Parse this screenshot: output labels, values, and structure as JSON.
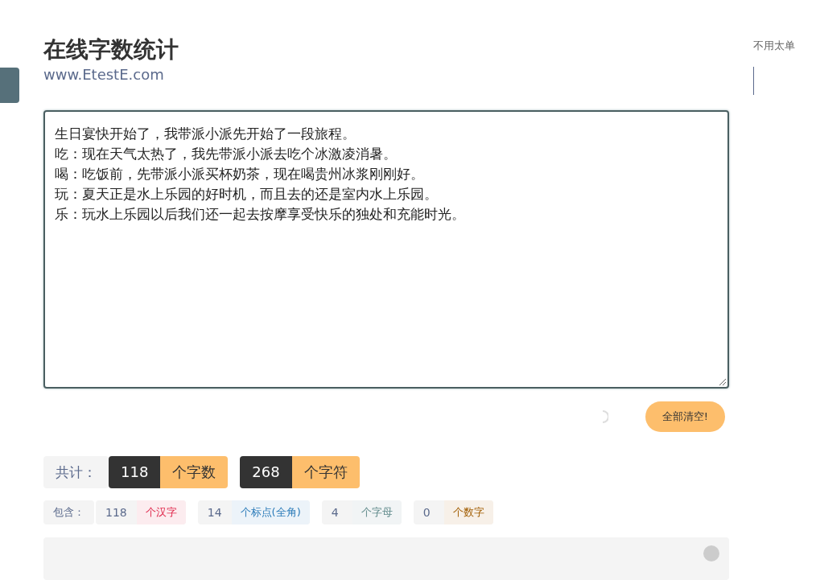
{
  "header": {
    "title": "在线字数统计",
    "subtitle": "www.EtestE.com"
  },
  "side_note": "不用太单",
  "editor": {
    "lines": [
      "生日宴快开始了，我带派小派先开始了一段旅程。",
      "吃：现在天气太热了，我先带派小派去吃个冰激凌消暑。",
      "喝：吃饭前，先带派小派买杯奶茶，现在喝贵州冰浆刚刚好。",
      "玩：夏天正是水上乐园的好时机，而且去的还是室内水上乐园。",
      "乐：玩水上乐园以后我们还一起去按摩享受快乐的独处和充能时光。"
    ]
  },
  "clear_button": "全部清空!",
  "totals": {
    "label": "共计：",
    "items": [
      {
        "count": "118",
        "unit": "个字数"
      },
      {
        "count": "268",
        "unit": "个字符"
      }
    ]
  },
  "breakdown": {
    "label": "包含：",
    "items": [
      {
        "count": "118",
        "unit": "个汉字",
        "color": "#e0284c"
      },
      {
        "count": "14",
        "unit": "个标点(全角)",
        "color": "#2b7bb9"
      },
      {
        "count": "4",
        "unit": "个字母",
        "color": "#5f8a8b"
      },
      {
        "count": "0",
        "unit": "个数字",
        "color": "#a15c00"
      }
    ]
  }
}
